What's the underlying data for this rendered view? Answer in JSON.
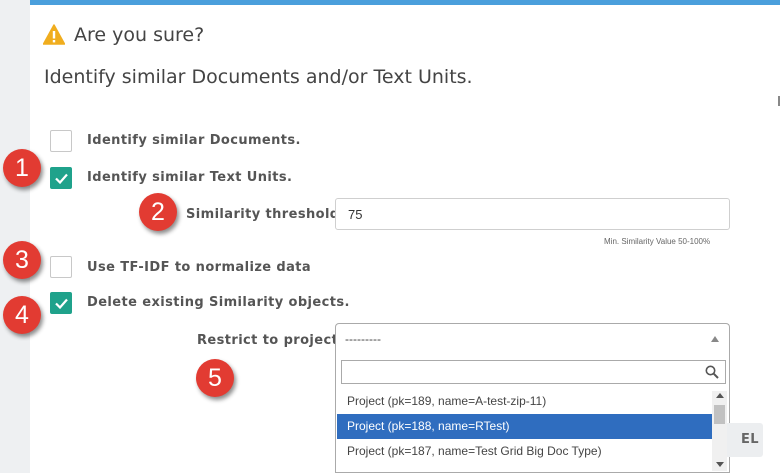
{
  "dialog": {
    "title": "Are you sure?",
    "subtitle": "Identify similar Documents and/or Text Units."
  },
  "options": {
    "similar_documents": {
      "label": "Identify similar Documents.",
      "checked": false
    },
    "similar_text_units": {
      "label": "Identify similar Text Units.",
      "checked": true
    },
    "tfidf": {
      "label": "Use TF-IDF to normalize data",
      "checked": false
    },
    "delete_existing": {
      "label": "Delete existing Similarity objects.",
      "checked": true
    }
  },
  "threshold": {
    "label": "Similarity threshold:",
    "value": "75",
    "help": "Min. Similarity Value 50-100%"
  },
  "project": {
    "label": "Restrict to project:",
    "selected": "---------",
    "search_value": "",
    "items": [
      "Project (pk=189, name=A-test-zip-11)",
      "Project (pk=188, name=RTest)",
      "Project (pk=187, name=Test Grid Big Doc Type)"
    ],
    "highlighted_index": 1
  },
  "annotations": [
    "1",
    "2",
    "3",
    "4",
    "5"
  ],
  "footer": {
    "cancel_label_visible": "EL"
  },
  "colors": {
    "accent_bar": "#4a9fdc",
    "checkbox_checked": "#1fa28b",
    "badge": "#e23b32",
    "selected_option": "#2f6dbf",
    "warning_icon": "#f0ad1e"
  }
}
